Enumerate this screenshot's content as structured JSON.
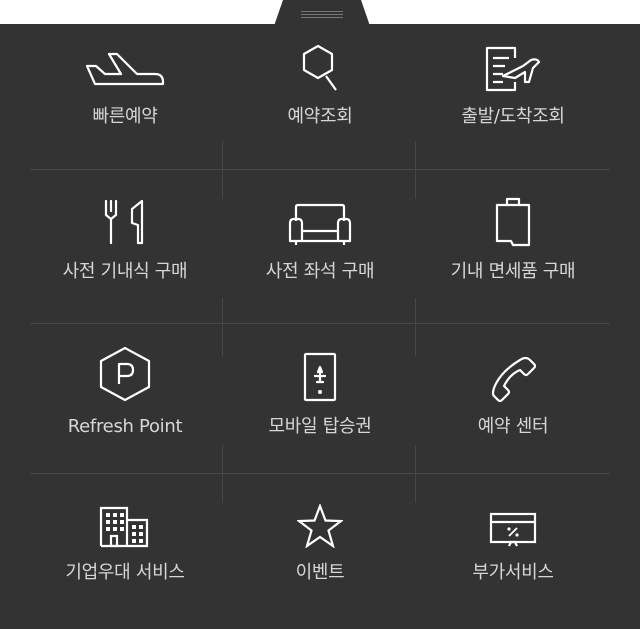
{
  "menu": {
    "items": [
      {
        "id": "quick-booking",
        "label": "빠른예약",
        "icon": "airplane-icon"
      },
      {
        "id": "booking-lookup",
        "label": "예약조회",
        "icon": "search-icon"
      },
      {
        "id": "flight-status",
        "label": "출발/도착조회",
        "icon": "flight-document-icon"
      },
      {
        "id": "inflight-meal",
        "label": "사전 기내식 구매",
        "icon": "cutlery-icon"
      },
      {
        "id": "seat-purchase",
        "label": "사전 좌석 구매",
        "icon": "sofa-seat-icon"
      },
      {
        "id": "duty-free",
        "label": "기내 면세품 구매",
        "icon": "shopping-bag-icon"
      },
      {
        "id": "refresh-point",
        "label": "Refresh Point",
        "icon": "parking-hexagon-icon"
      },
      {
        "id": "mobile-boarding-pass",
        "label": "모바일 탑승권",
        "icon": "mobile-pass-icon"
      },
      {
        "id": "reservation-center",
        "label": "예약 센터",
        "icon": "phone-icon"
      },
      {
        "id": "corporate-service",
        "label": "기업우대 서비스",
        "icon": "building-icon"
      },
      {
        "id": "event",
        "label": "이벤트",
        "icon": "star-icon"
      },
      {
        "id": "extra-services",
        "label": "부가서비스",
        "icon": "discount-card-icon"
      }
    ]
  },
  "colors": {
    "panel": "#333333",
    "text": "#d6d6d6",
    "icon": "#ffffff",
    "divider": "#474747"
  }
}
